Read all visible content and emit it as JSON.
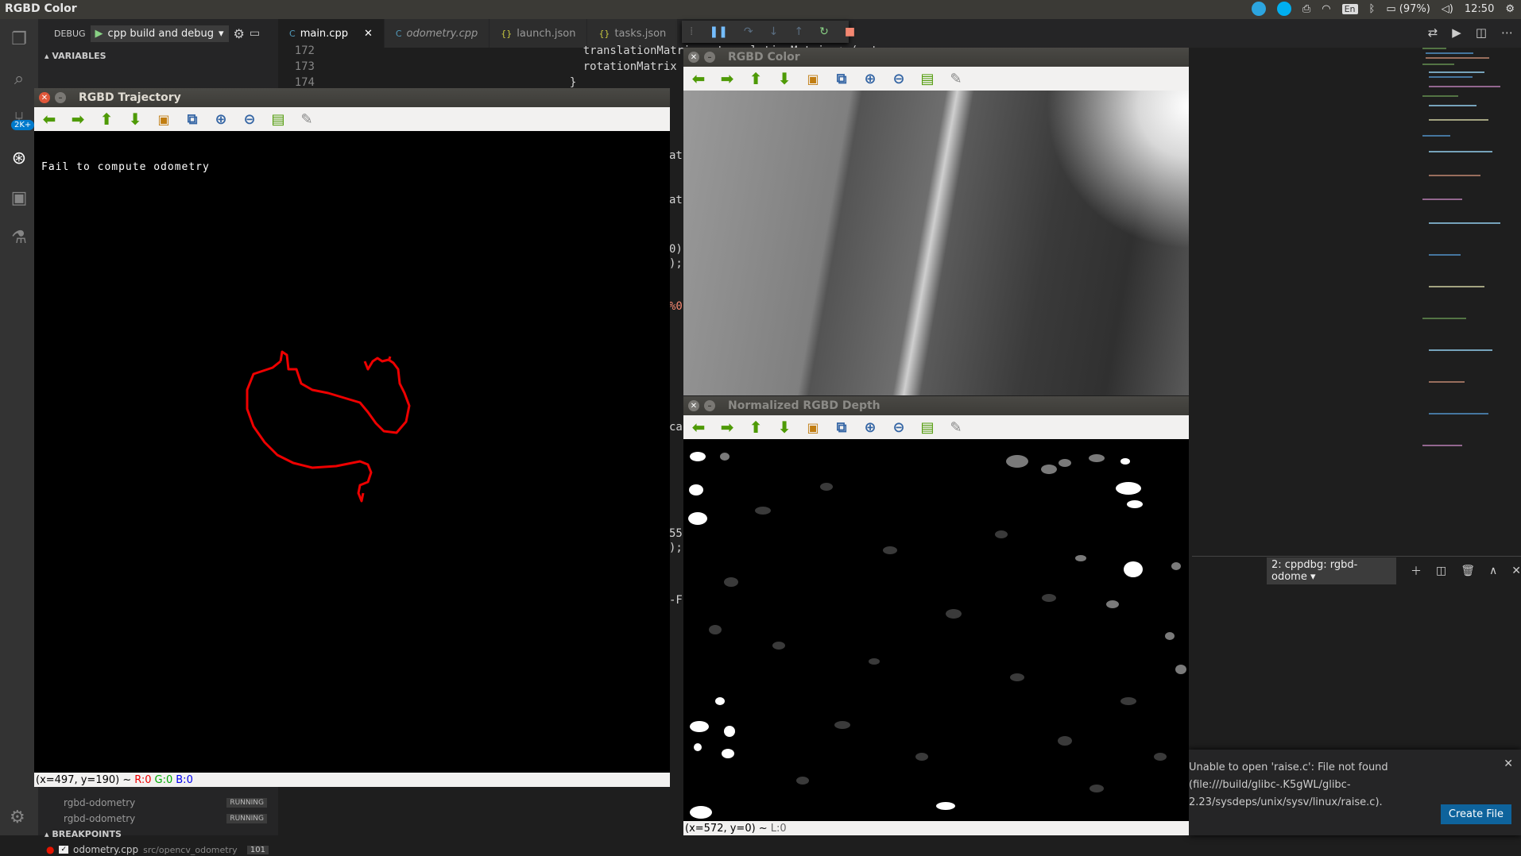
{
  "topbar": {
    "app_title": "RGBD Color",
    "keyboard": "En",
    "battery": "(97%)",
    "time": "12:50"
  },
  "sidebar": {
    "debug_label": "DEBUG",
    "config": "cpp build and debug",
    "variables_header": "VARIABLES",
    "threads": [
      {
        "name": "rgbd-odometry",
        "status": "RUNNING"
      },
      {
        "name": "rgbd-odometry",
        "status": "RUNNING"
      }
    ],
    "breakpoints_header": "BREAKPOINTS",
    "breakpoint": {
      "file": "odometry.cpp",
      "path": "src/opencv_odometry",
      "line": "101"
    },
    "badge": "2K+"
  },
  "tabs": [
    {
      "label": "main.cpp",
      "icon": "C"
    },
    {
      "label": "odometry.cpp",
      "icon": "C"
    },
    {
      "label": "launch.json",
      "icon": "{}"
    },
    {
      "label": "tasks.json",
      "icon": "{}"
    }
  ],
  "editor": {
    "lines": [
      {
        "num": "172",
        "code": "    translationMatrix = translationMatrix + (rot"
      },
      {
        "num": "173",
        "code": "    rotationMatrix = rotationMat * rotationMatrix;"
      },
      {
        "num": "174",
        "code": "  }"
      }
    ],
    "fragments": [
      "at",
      "at",
      "0)",
      ");",
      "%0",
      "ca",
      "55",
      ");",
      "-F"
    ]
  },
  "panel": {
    "terminal_select": "2: cppdbg: rgbd-odome"
  },
  "notification": {
    "message": "Unable to open 'raise.c': File not found (file:///build/glibc-.K5gWL/glibc-2.23/sysdeps/unix/sysv/linux/raise.c).",
    "button": "Create File"
  },
  "windows": {
    "trajectory": {
      "title": "RGBD Trajectory",
      "overlay": "Fail to compute odometry",
      "status": {
        "coords": "(x=497, y=190) ~",
        "r": "R:0",
        "g": "G:0",
        "b": "B:0"
      }
    },
    "color": {
      "title": "RGBD Color"
    },
    "depth": {
      "title": "Normalized RGBD Depth",
      "status": {
        "coords": "(x=572, y=0) ~",
        "l": "L:0"
      }
    }
  }
}
